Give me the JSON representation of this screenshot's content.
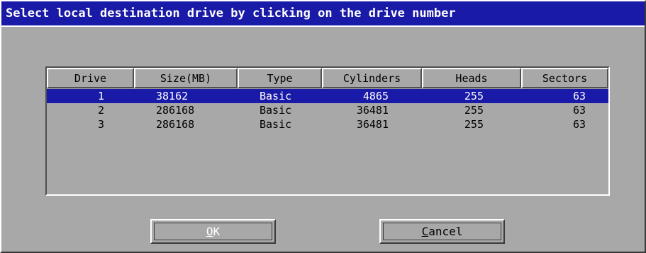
{
  "window": {
    "title": "Select local destination drive by clicking on the drive number"
  },
  "table": {
    "columns": [
      "Drive",
      "Size(MB)",
      "Type",
      "Cylinders",
      "Heads",
      "Sectors"
    ],
    "rows": [
      {
        "drive": "1",
        "size": "38162",
        "type": "Basic",
        "cylinders": "4865",
        "heads": "255",
        "sectors": "63",
        "selected": true
      },
      {
        "drive": "2",
        "size": "286168",
        "type": "Basic",
        "cylinders": "36481",
        "heads": "255",
        "sectors": "63",
        "selected": false
      },
      {
        "drive": "3",
        "size": "286168",
        "type": "Basic",
        "cylinders": "36481",
        "heads": "255",
        "sectors": "63",
        "selected": false
      }
    ]
  },
  "buttons": {
    "ok": {
      "label": "OK",
      "mnemonic": "O",
      "rest": "K"
    },
    "cancel": {
      "label": "Cancel",
      "mnemonic": "C",
      "rest": "ancel"
    }
  },
  "colors": {
    "title_bar": "#1a1aa8",
    "selection": "#1a1aa8",
    "face": "#a8a8a8"
  }
}
